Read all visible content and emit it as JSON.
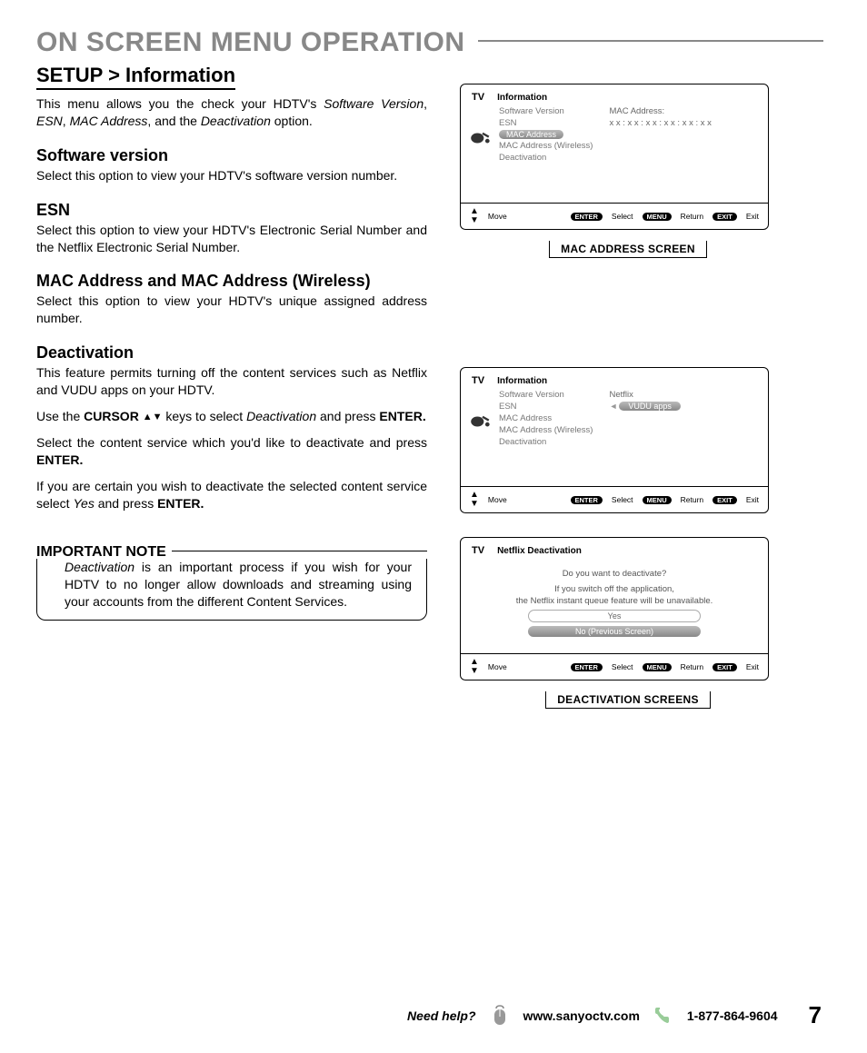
{
  "page_title": "ON SCREEN MENU OPERATION",
  "breadcrumb": "SETUP > Information",
  "intro": {
    "pre": "This menu allows you the check your HDTV's ",
    "i1": "Software Version",
    "sep1": ", ",
    "i2": "ESN",
    "sep2": ", ",
    "i3": "MAC Address",
    "sep3": ", and the ",
    "i4": "Deactivation",
    "post": " option."
  },
  "sections": {
    "sw": {
      "h": "Software version",
      "p": "Select this option to view your HDTV's software version number."
    },
    "esn": {
      "h": "ESN",
      "p": "Select this option to view your HDTV's Electronic Serial Number and the Netflix Electronic Serial Number."
    },
    "mac": {
      "h": "MAC Address and MAC Address (Wireless)",
      "p": "Select this option to view your HDTV's unique assigned address number."
    },
    "deact": {
      "h": "Deactivation",
      "p": "This feature permits turning off the content services such as Netflix and VUDU apps on your HDTV.",
      "step1_a": "Use the ",
      "step1_b": "CURSOR ",
      "step1_c": " keys to select ",
      "step1_d": "Deactivation",
      "step1_e": " and press ",
      "step1_f": "ENTER.",
      "step2_a": "Select the content service which you'd like to deactivate and press ",
      "step2_b": "ENTER.",
      "step3_a": "If you are certain you wish to deactivate the selected content service select ",
      "step3_b": "Yes",
      "step3_c": " and press ",
      "step3_d": "ENTER."
    }
  },
  "note": {
    "title": "IMPORTANT NOTE",
    "i": "Deactivation",
    "rest": " is an important process if you wish for your HDTV to no longer allow downloads and streaming using your accounts from the different Content Services."
  },
  "screens": {
    "s1": {
      "tv": "TV",
      "heading": "Information",
      "items": [
        "Software Version",
        "ESN",
        "MAC Address",
        "MAC Address (Wireless)",
        "Deactivation"
      ],
      "selected": 2,
      "detail_label": "MAC Address:",
      "detail_value": "x x : x x : x x : x x : x x : x x"
    },
    "caption1": "MAC ADDRESS SCREEN",
    "s2": {
      "tv": "TV",
      "heading": "Information",
      "items": [
        "Software Version",
        "ESN",
        "MAC Address",
        "MAC Address (Wireless)",
        "Deactivation"
      ],
      "detail_items": [
        "Netflix",
        "VUDU apps"
      ],
      "detail_selected": 1
    },
    "s3": {
      "tv": "TV",
      "heading": "Netflix Deactivation",
      "q": "Do you want to deactivate?",
      "l1": "If you switch off the application,",
      "l2": "the Netflix instant queue feature will be unavailable.",
      "opt_yes": "Yes",
      "opt_no": "No (Previous Screen)"
    },
    "caption2": "DEACTIVATION SCREENS",
    "footer": {
      "move": "Move",
      "enter_pill": "ENTER",
      "enter": "Select",
      "menu_pill": "MENU",
      "menu": "Return",
      "exit_pill": "EXIT",
      "exit": "Exit"
    }
  },
  "footer": {
    "need_help": "Need help?",
    "url": "www.sanyoctv.com",
    "phone": "1-877-864-9604",
    "page": "7"
  }
}
